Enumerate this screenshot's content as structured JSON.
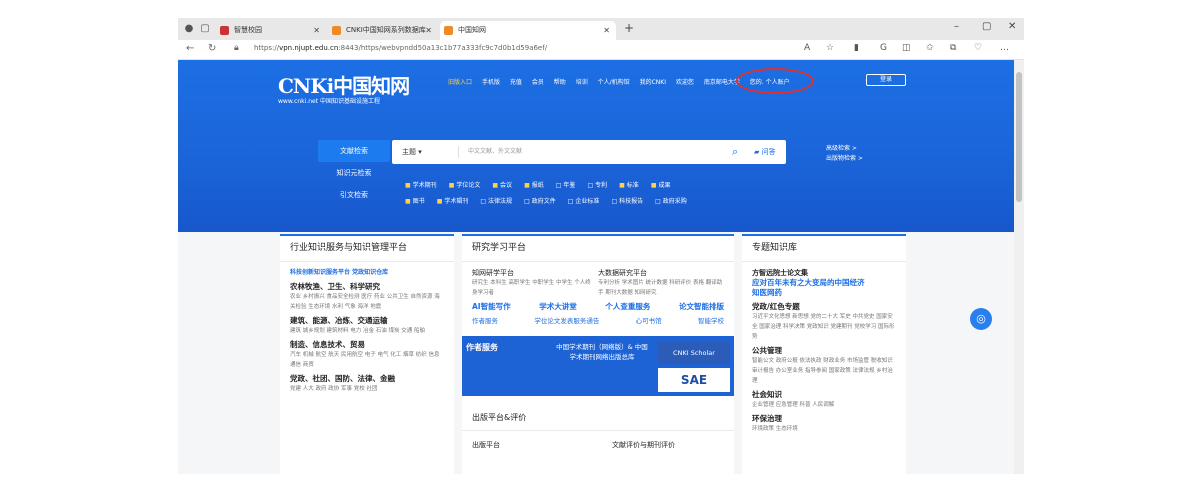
{
  "browser": {
    "tabs": [
      {
        "label": "智慧校园",
        "active": false
      },
      {
        "label": "CNKI中国知网系列数据库",
        "active": false
      },
      {
        "label": "中国知网",
        "active": true
      }
    ],
    "address_url_prefix": "https://",
    "address_url_host": "vpn.njupt.edu.cn",
    "address_url_rest": ":8443/https/webvpndd50a13c1b77a333fc9c7d0b1d59a6ef/",
    "window_controls": [
      "–",
      "▢",
      "✕"
    ]
  },
  "site": {
    "logo_text": "CNKi中国知网",
    "logo_sub": "www.cnki.net 中国知识基础设施工程",
    "top_nav": [
      "旧版入口",
      "手机版",
      "充值",
      "会员",
      "帮助",
      "培训",
      "个人/机构馆",
      "我的CNKI",
      "欢迎您"
    ],
    "institution": "南京邮电大学",
    "personal": "您的. 个人账户",
    "login_label": "登录"
  },
  "search": {
    "modes": [
      "文献检索",
      "知识元检索",
      "引文检索"
    ],
    "field": "主题",
    "placeholder": "中文文献、外文文献",
    "ask_label": "问答",
    "adv_links": [
      "高级检索 >",
      "出版物检索 >"
    ],
    "checks_row1": [
      {
        "label": "学术期刊",
        "checked": true
      },
      {
        "label": "学位论文",
        "checked": true
      },
      {
        "label": "会议",
        "checked": true
      },
      {
        "label": "报纸",
        "checked": true
      },
      {
        "label": "年鉴",
        "checked": false
      },
      {
        "label": "专利",
        "checked": false
      },
      {
        "label": "标准",
        "checked": true
      },
      {
        "label": "成果",
        "checked": true
      }
    ],
    "checks_row2": [
      {
        "label": "图书",
        "checked": true
      },
      {
        "label": "学术辑刊",
        "checked": true
      },
      {
        "label": "法律法规",
        "checked": false
      },
      {
        "label": "政府文件",
        "checked": false
      },
      {
        "label": "企业标准",
        "checked": false
      },
      {
        "label": "科技报告",
        "checked": false
      },
      {
        "label": "政府采购",
        "checked": false
      }
    ]
  },
  "col1": {
    "title": "行业知识服务与知识管理平台",
    "links": "科技创新知识服务平台  党政知识仓库",
    "cats": [
      {
        "name": "农林牧渔、卫生、科学研究",
        "sub": "农业  乡村振兴  食品安全检测  医疗  药业  公共卫生  自然资源  海关检验  生态环境  水利  气象  海洋  地震"
      },
      {
        "name": "建筑、能源、冶炼、交通运输",
        "sub": "建筑  城乡规划  建筑材料  电力  冶金  石油  煤炭  交通  船舶"
      },
      {
        "name": "制造、信息技术、贸易",
        "sub": "汽车  机械  航空  航天  民用航空  电子  电气  化工  烟草  纺织  信息通信  商贸"
      },
      {
        "name": "党政、社团、国防、法律、金融",
        "sub": "党建  人大  政府  政协  军事  党校  社团"
      }
    ]
  },
  "col2": {
    "title": "研究学习平台",
    "left_title": "知网研学平台",
    "left_sub": "研究生  本科生  高职学生  中职学生  中学生  个人终身学习者",
    "right_title": "大数据研究平台",
    "right_sub": "专利分析  学术图片  统计数据  科研评价  表格  翻译助手  期刊大数据  知网研究",
    "feature_row": [
      "AI智能写作",
      "学术大讲堂",
      "个人查重服务",
      "论文智能排版"
    ],
    "service_row": [
      "作者服务",
      "学位论文发表服务通告",
      "心可书馆",
      "智能学校"
    ],
    "banner_left": "作者服务",
    "banner_mid": "中国学术期刊（网络版）& 中国学术期刊网络出版总库",
    "banner_right": "CNKI Scholar",
    "banner_sae": "SAE",
    "pub_title": "出版平台&评价",
    "pub_left": "出版平台",
    "pub_right": "文献评价与期刊评价"
  },
  "col3": {
    "title": "专题知识库",
    "items": [
      "方智远院士论文集",
      "应对百年未有之大变局的中国经济",
      "知医网药"
    ],
    "sec1": "党政/红色专题",
    "sec1_sub": "习近平文化思想  新思想  党的二十大  军史  中共党史  国家安全  国家治理  科学决策  党政知识  党建期刊  党校学习  国际形势",
    "sec2": "公共管理",
    "sec2_sub": "智能公文  政府公报  依法执政  财政业务  市场监管  税收知识  审计报告  办公室业务  指导参阅  国家政策  法律法规  乡村治理",
    "sec3": "社会知识",
    "sec3_sub": "企业管理  应急管理  科普  人民调解",
    "sec4": "环保治理",
    "sec4_sub": "环境政策  生态环境"
  },
  "colors": {
    "hero_blue": "#1d6fe4",
    "annotation_red": "#e03030"
  }
}
